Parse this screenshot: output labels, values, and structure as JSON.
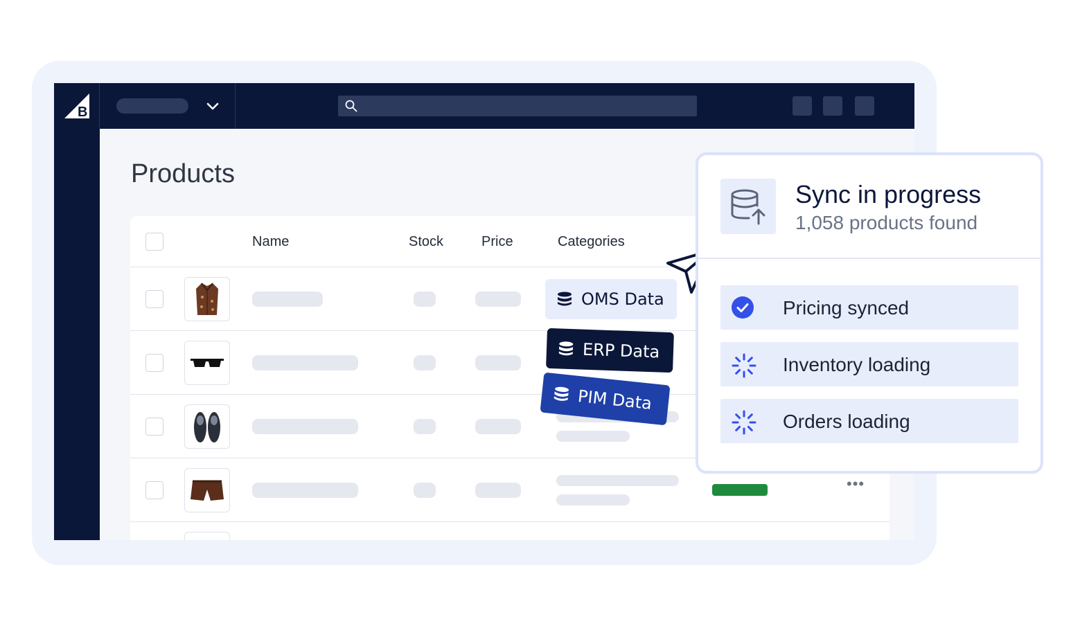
{
  "page": {
    "title": "Products"
  },
  "table": {
    "headers": {
      "name": "Name",
      "stock": "Stock",
      "price": "Price",
      "categories": "Categories"
    }
  },
  "tags": {
    "oms": "OMS Data",
    "erp": "ERP Data",
    "pim": "PIM Data"
  },
  "sync": {
    "title": "Sync in progress",
    "subtitle": "1,058 products found",
    "items": [
      {
        "label": "Pricing synced",
        "state": "done",
        "icon": "check-circle-icon"
      },
      {
        "label": "Inventory loading",
        "state": "loading",
        "icon": "spinner-icon"
      },
      {
        "label": "Orders loading",
        "state": "loading",
        "icon": "spinner-icon"
      }
    ]
  },
  "colors": {
    "navy": "#0b1739",
    "accent": "#3350e8",
    "tag_pim": "#1f40a8",
    "status_green": "#1f8a3e",
    "panel_bg": "#e8edfc"
  }
}
